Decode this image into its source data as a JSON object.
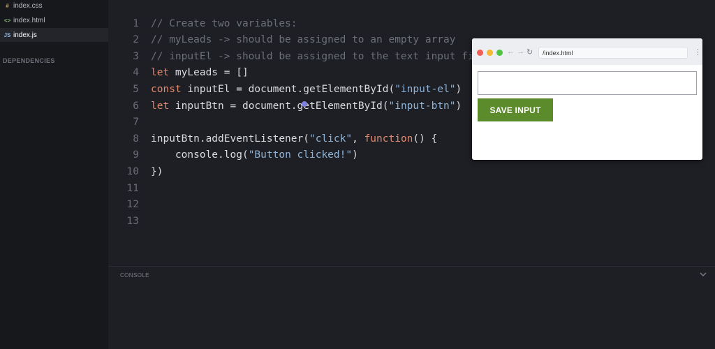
{
  "sidebar": {
    "files": [
      {
        "icon": "#",
        "name": "index.css"
      },
      {
        "icon": "<>",
        "name": "index.html"
      },
      {
        "icon": "JS",
        "name": "index.js"
      }
    ],
    "dependencies_label": "DEPENDENCIES"
  },
  "editor": {
    "lines": [
      {
        "n": "1",
        "segs": [
          {
            "t": "// Create two variables:",
            "c": "cm"
          }
        ]
      },
      {
        "n": "2",
        "segs": [
          {
            "t": "// myLeads -> should be assigned to an empty array",
            "c": "cm"
          }
        ]
      },
      {
        "n": "3",
        "segs": [
          {
            "t": "// inputEl -> should be assigned to the text input fi",
            "c": "cm"
          }
        ]
      },
      {
        "n": "4",
        "segs": [
          {
            "t": "let",
            "c": "kw"
          },
          {
            "t": " myLeads = []",
            "c": ""
          }
        ]
      },
      {
        "n": "5",
        "segs": [
          {
            "t": "const",
            "c": "kw"
          },
          {
            "t": " inputEl = document.getElementById(",
            "c": ""
          },
          {
            "t": "\"input-el\"",
            "c": "str"
          },
          {
            "t": ")",
            "c": ""
          }
        ]
      },
      {
        "n": "6",
        "segs": [
          {
            "t": "let",
            "c": "kw"
          },
          {
            "t": " inputBtn = document.getElementById(",
            "c": ""
          },
          {
            "t": "\"input-btn\"",
            "c": "str"
          },
          {
            "t": ")",
            "c": ""
          }
        ]
      },
      {
        "n": "7",
        "segs": []
      },
      {
        "n": "8",
        "segs": [
          {
            "t": "inputBtn.addEventListener(",
            "c": ""
          },
          {
            "t": "\"click\"",
            "c": "str"
          },
          {
            "t": ", ",
            "c": ""
          },
          {
            "t": "function",
            "c": "kw"
          },
          {
            "t": "() {",
            "c": ""
          }
        ]
      },
      {
        "n": "9",
        "segs": [
          {
            "t": "    console.log(",
            "c": ""
          },
          {
            "t": "\"Button clicked!\"",
            "c": "str"
          },
          {
            "t": ")",
            "c": ""
          }
        ]
      },
      {
        "n": "10",
        "segs": [
          {
            "t": "})",
            "c": ""
          }
        ]
      },
      {
        "n": "11",
        "segs": []
      },
      {
        "n": "12",
        "segs": []
      },
      {
        "n": "13",
        "segs": []
      }
    ]
  },
  "console": {
    "label": "CONSOLE"
  },
  "browser": {
    "url": "/index.html",
    "save_button": "SAVE INPUT",
    "input_value": ""
  },
  "colors": {
    "traffic_red": "#f25d54",
    "traffic_yellow": "#f7b731",
    "traffic_green": "#4fc442",
    "button_green": "#5b8b2a"
  }
}
